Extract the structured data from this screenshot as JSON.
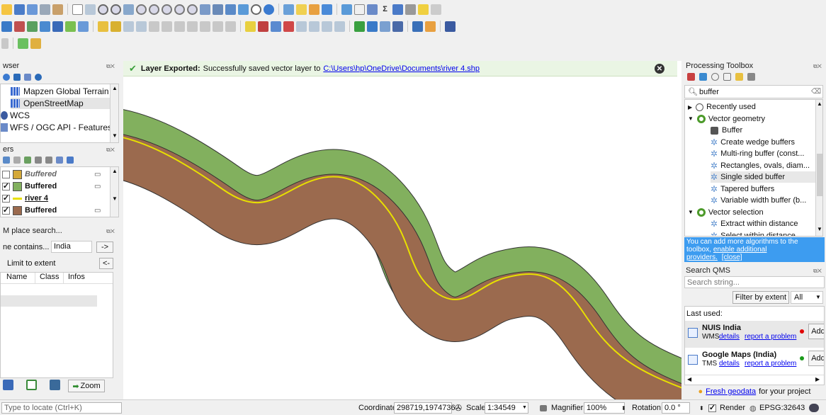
{
  "message_bar": {
    "title": "Layer Exported:",
    "text": "Successfully saved vector layer to",
    "path": "C:\\Users\\hp\\OneDrive\\Documents\\river 4.shp"
  },
  "browser": {
    "title": "wser",
    "items": [
      "Mapzen Global Terrain",
      "OpenStreetMap",
      "WCS",
      "WFS / OGC API - Features"
    ]
  },
  "layers": {
    "title": "ers",
    "items": [
      {
        "name": "Buffered",
        "checked": false,
        "color": "#d4a838"
      },
      {
        "name": "Buffered",
        "checked": true,
        "color": "#82b05e"
      },
      {
        "name": "river 4",
        "checked": true,
        "color": "#e8e000"
      },
      {
        "name": "Buffered",
        "checked": true,
        "color": "#9b6a4e"
      }
    ]
  },
  "osm_search": {
    "title": "M place search...",
    "contains_label": "ne contains...",
    "query": "India",
    "go_label": "->",
    "limit_label": "Limit to extent",
    "back_label": "<-",
    "columns": [
      "Name",
      "Class",
      "Infos"
    ],
    "zoom_label": "Zoom"
  },
  "processing": {
    "title": "Processing Toolbox",
    "search_value": "buffer",
    "recently_used": "Recently used",
    "groups": [
      {
        "name": "Vector geometry",
        "items": [
          "Buffer",
          "Create wedge buffers",
          "Multi-ring buffer (const...",
          "Rectangles, ovals, diam...",
          "Single sided buffer",
          "Tapered buffers",
          "Variable width buffer (b..."
        ]
      },
      {
        "name": "Vector selection",
        "items": [
          "Extract within distance",
          "Select within distance"
        ]
      }
    ],
    "hint_text": "You can add more algorithms to the toolbox,",
    "hint_link": "enable additional",
    "hint_link2": "providers.",
    "hint_close": "[close]"
  },
  "qms": {
    "title": "Search QMS",
    "placeholder": "Search string...",
    "filter_label": "Filter by extent",
    "filter_value": "All",
    "last_used": "Last used:",
    "services": [
      {
        "name": "NUIS India",
        "type": "WMS",
        "details": "details",
        "report": "report a problem",
        "status_color": "#e00000",
        "add": "Add"
      },
      {
        "name": "Google Maps (India)",
        "type": "TMS",
        "details": "details",
        "report": "report a problem",
        "status_color": "#1a9a1a",
        "add": "Add"
      }
    ],
    "footer_link": "Fresh geodata",
    "footer_text": "for your project"
  },
  "statusbar": {
    "locator_placeholder": "Type to locate (Ctrl+K)",
    "coordinate_label": "Coordinate",
    "coordinate_value": "298719,1974736",
    "scale_label": "Scale",
    "scale_value": "1:34549",
    "magnifier_label": "Magnifier",
    "magnifier_value": "100%",
    "rotation_label": "Rotation",
    "rotation_value": "0.0 °",
    "render_label": "Render",
    "crs": "EPSG:32643"
  },
  "colors": {
    "outer_buffer": "#82b05e",
    "inner_buffer": "#9b6a4e",
    "river": "#e8e000",
    "message_bg": "#eaf5e4",
    "hint_bg": "#3d9cf0"
  }
}
